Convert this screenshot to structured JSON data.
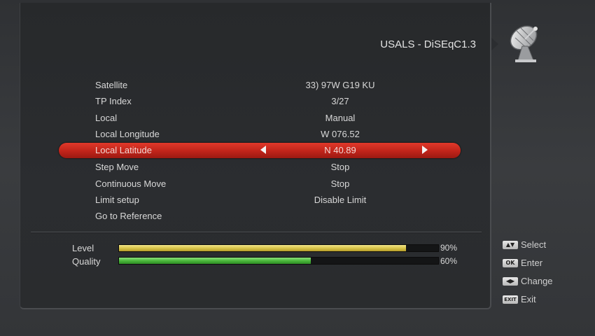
{
  "header": {
    "title": "USALS - DiSEqC1.3",
    "icon": "satellite-dish-icon"
  },
  "menu": {
    "items": [
      {
        "label": "Satellite",
        "value": "33) 97W G19 KU"
      },
      {
        "label": "TP Index",
        "value": "3/27"
      },
      {
        "label": "Local",
        "value": "Manual"
      },
      {
        "label": "Local Longitude",
        "value": "W 076.52"
      },
      {
        "label": "Local Latitude",
        "value": "N 40.89"
      },
      {
        "label": "Step Move",
        "value": "Stop"
      },
      {
        "label": "Continuous Move",
        "value": "Stop"
      },
      {
        "label": "Limit setup",
        "value": "Disable Limit"
      },
      {
        "label": "Go to Reference",
        "value": ""
      }
    ],
    "selected_index": 4,
    "highlight_color": "#d0301f"
  },
  "signal": {
    "level": {
      "label": "Level",
      "percent": 90,
      "text": "90%",
      "color": "#d9c54a"
    },
    "quality": {
      "label": "Quality",
      "percent": 60,
      "text": "60%",
      "color": "#4bb83c"
    }
  },
  "help": [
    {
      "key": "▲▼",
      "text": "Select",
      "icon": "up-down-key-icon"
    },
    {
      "key": "OK",
      "text": "Enter",
      "icon": "ok-key-icon"
    },
    {
      "key": "◀▶",
      "text": "Change",
      "icon": "left-right-key-icon"
    },
    {
      "key": "EXIT",
      "text": "Exit",
      "icon": "exit-key-icon"
    }
  ]
}
